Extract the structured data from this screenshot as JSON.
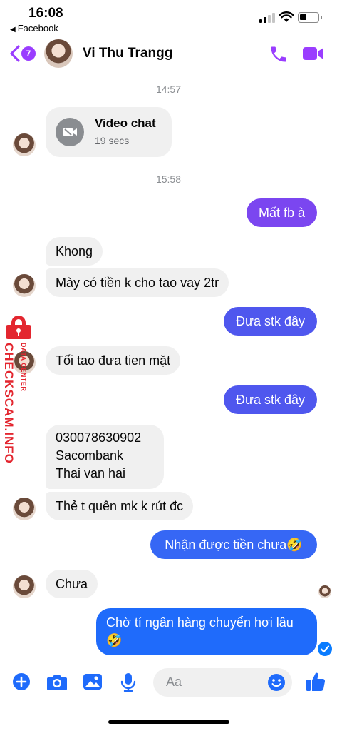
{
  "status_bar": {
    "time": "16:08",
    "back_app": "Facebook"
  },
  "header": {
    "back_badge": "7",
    "contact_name": "Vi Thu Trangg"
  },
  "messages": {
    "ts1": "14:57",
    "video_chat_title": "Video chat",
    "video_chat_duration": "19 secs",
    "ts2": "15:58",
    "m1": "Mất fb à",
    "m2": "Khong",
    "m3": "Mày có tiền k cho tao vay 2tr",
    "m4": "Đưa stk đây",
    "m5": "Tối tao đưa tien mặt",
    "m6": "Đưa stk đây",
    "account": {
      "number": "030078630902",
      "bank": "Sacombank",
      "holder": "Thai van hai"
    },
    "m7": "Thẻ t quên mk k rút đc",
    "m8": "Nhận được tiền chưa🤣",
    "m9": "Chưa",
    "m10_line1": "Chờ tí ngân hàng chuyển hơi lâu",
    "m10_line2": "🤣"
  },
  "watermark": {
    "main": "CHECKSCAM.INFO",
    "small": "DATA CENTER"
  },
  "composer": {
    "placeholder": "Aa"
  },
  "colors": {
    "accent_purple": "#9a3dff",
    "bubble_purple": "#7b46f0",
    "bubble_indigo": "#4f57ee",
    "bubble_blue": "#1f6bfb",
    "incoming": "#f0f0f0",
    "watermark_red": "#e3262f"
  }
}
